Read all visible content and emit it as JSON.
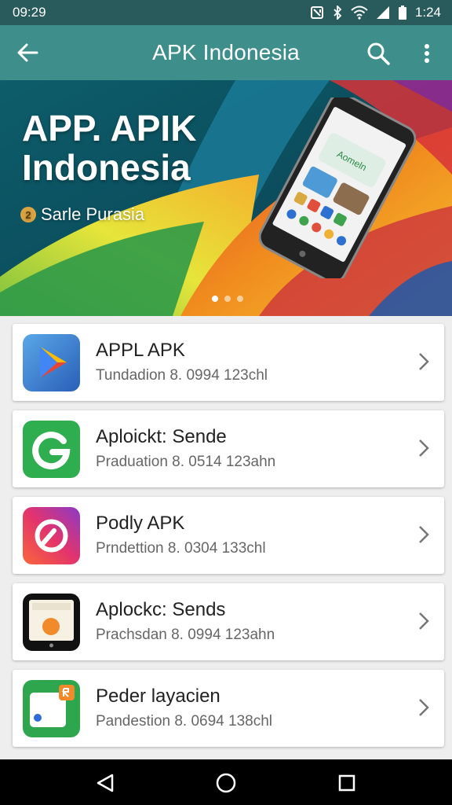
{
  "status_bar": {
    "time": "09:29",
    "battery_time": "1:24"
  },
  "app_bar": {
    "title": "APK Indonesia"
  },
  "banner": {
    "title_line1": "APP. APIK",
    "title_line2": "Indonesia",
    "subtitle": "Sarle Purasia",
    "badge": "2",
    "phone_screen_text": "Aomeln",
    "carousel_pages": 3,
    "carousel_active": 1
  },
  "apps": [
    {
      "name": "APPL APK",
      "meta": "Tundadion 8. 0994 123chl",
      "icon": "play-store-icon"
    },
    {
      "name": "Aploickt: Sende",
      "meta": "Praduation 8. 0514 123ahn",
      "icon": "g-letter-icon"
    },
    {
      "name": "Podly APK",
      "meta": "Prndettion 8. 0304 133chl",
      "icon": "circle-logo-icon"
    },
    {
      "name": "Aplockc: Sends",
      "meta": "Prachsdan 8. 0994 123ahn",
      "icon": "tablet-icon"
    },
    {
      "name": "Peder layacien",
      "meta": "Pandestion 8. 0694 138chl",
      "icon": "card-app-icon"
    }
  ],
  "colors": {
    "status_bar": "#2a5b5c",
    "app_bar": "#3e8f8c",
    "card": "#ffffff",
    "background": "#eeeeee"
  }
}
